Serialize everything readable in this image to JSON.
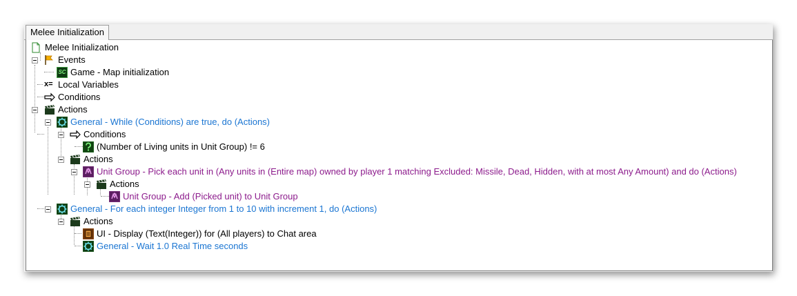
{
  "tab": {
    "label": "Melee Initialization"
  },
  "tree": {
    "root": "Melee Initialization",
    "events": "Events",
    "event_map_init": "Game - Map initialization",
    "event_icon_text": "SC",
    "local_variables": "Local Variables",
    "local_variables_icon_text": "x=",
    "conditions": "Conditions",
    "actions": "Actions",
    "while_action": "General - While (Conditions) are true, do (Actions)",
    "while_conditions": "Conditions",
    "while_condition_expr": "(Number of Living units in Unit Group) != 6",
    "while_actions": "Actions",
    "pick_each_unit": "Unit Group - Pick each unit in (Any units in (Entire map) owned by player 1 matching Excluded: Missile, Dead, Hidden, with at most Any Amount) and do (Actions)",
    "pick_actions": "Actions",
    "add_unit": "Unit Group - Add (Picked unit) to Unit Group",
    "for_each_integer": "General - For each integer Integer from 1 to 10 with increment 1, do (Actions)",
    "for_actions": "Actions",
    "ui_display": "UI - Display (Text(Integer)) for (All players) to Chat area",
    "wait": "General - Wait 1.0 Real Time seconds"
  },
  "colors": {
    "general": "#1a75d2",
    "unit_group": "#8c1b8c",
    "default": "#000000"
  }
}
